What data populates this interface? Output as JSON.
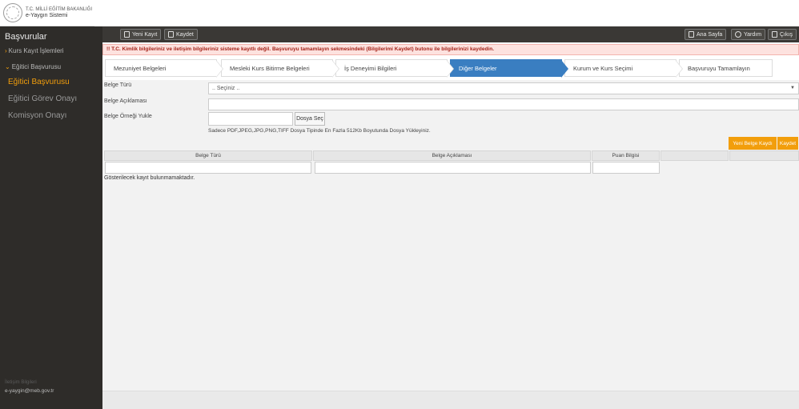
{
  "logo": {
    "line1": "T.C. MİLLİ EĞİTİM BAKANLIĞI",
    "line2": "e-Yaygın Sistemi"
  },
  "sidebar": {
    "title": "Başvurular",
    "items": [
      {
        "label": "Kurs Kayıt İşlemleri"
      },
      {
        "label": "Eğitici Başvurusu"
      }
    ],
    "subitems": [
      {
        "label": "Eğitici Başvurusu"
      },
      {
        "label": "Eğitici Görev Onayı"
      },
      {
        "label": "Komisyon Onayı"
      }
    ],
    "contact_label": "İletişim Bilgileri",
    "contact_email": "e-yaygin@meb.gov.tr"
  },
  "toolbar": {
    "new_label": "Yeni Kayıt",
    "save_label": "Kaydet",
    "home_label": "Ana Sayfa",
    "help_label": "Yardım",
    "exit_label": "Çıkış"
  },
  "alert": {
    "text": "!! T.C. Kimlik bilgileriniz ve iletişim bilgileriniz sisteme kayıtlı değil. Başvuruyu tamamlayın sekmesindeki (Bilgilerimi Kaydet) butonu ile bilgilerinizi kaydedin."
  },
  "steps": [
    {
      "label": "Mezuniyet Belgeleri"
    },
    {
      "label": "Mesleki Kurs Bitirme Belgeleri"
    },
    {
      "label": "İş Deneyimi Bilgileri"
    },
    {
      "label": "Diğer Belgeler"
    },
    {
      "label": "Kurum ve Kurs Seçimi"
    },
    {
      "label": "Başvuruyu Tamamlayın"
    }
  ],
  "form": {
    "belge_turu_label": "Belge Türü",
    "belge_turu_value": ".. Seçiniz ..",
    "belge_aciklamasi_label": "Belge Açıklaması",
    "belge_ornegi_label": "Belge Örneği Yukle",
    "file_button": "Dosya Seç",
    "hint": "Sadece PDF,JPEG,JPG,PNG,TIFF Dosya Tipinde En Fazla 512Kb Boyutunda Dosya Yükleyiniz."
  },
  "buttons": {
    "new_doc": "Yeni Belge Kaydı",
    "save": "Kaydet"
  },
  "grid": {
    "columns": [
      "Belge Türü",
      "Belge Açıklaması",
      "Puan Bilgisi"
    ],
    "empty_text": "Gösterilecek kayıt bulunmamaktadır."
  },
  "colors": {
    "sidebar_bg": "#2e2c29",
    "accent_orange": "#f29e0c",
    "step_active": "#3a7ec1",
    "alert_text": "#a52218"
  }
}
